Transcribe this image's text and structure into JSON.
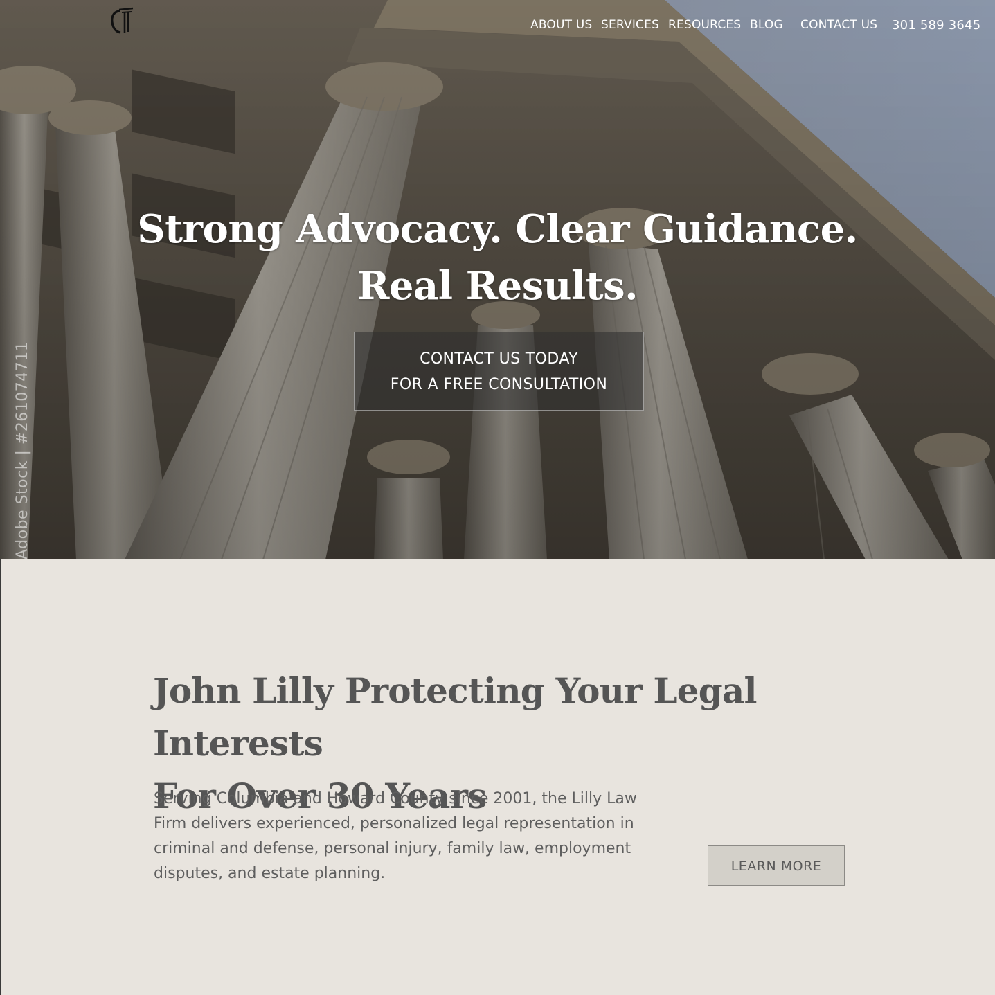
{
  "nav": {
    "items": [
      {
        "label": "ABOUT US"
      },
      {
        "label": "SERVICES"
      },
      {
        "label": "RESOURCES"
      },
      {
        "label": "BLOG"
      },
      {
        "label": "CONTACT US"
      }
    ],
    "phone": "301 589 3645"
  },
  "logo": {
    "icon": "law-firm-logo-icon"
  },
  "hero": {
    "title_line1": "Strong Advocacy. Clear Guidance.",
    "title_line2": "Real Results.",
    "cta_line1": "CONTACT US TODAY",
    "cta_line2": "FOR A FREE CONSULTATION",
    "watermark": "Adobe Stock | #261074711"
  },
  "about": {
    "title_line1": "John Lilly Protecting Your Legal Interests",
    "title_line2": "For Over 30 Years",
    "text": "Serving Columbia and Howard County since 2001, the Lilly Law Firm delivers experienced, personalized legal representation in criminal and defense, personal injury, family law, employment disputes, and estate planning.",
    "button": "LEARN MORE"
  },
  "colors": {
    "section_bg": "#e8e4de",
    "heading": "#555555",
    "body_text": "#5e5e5e",
    "cta_bg": "#2d2d2d"
  }
}
